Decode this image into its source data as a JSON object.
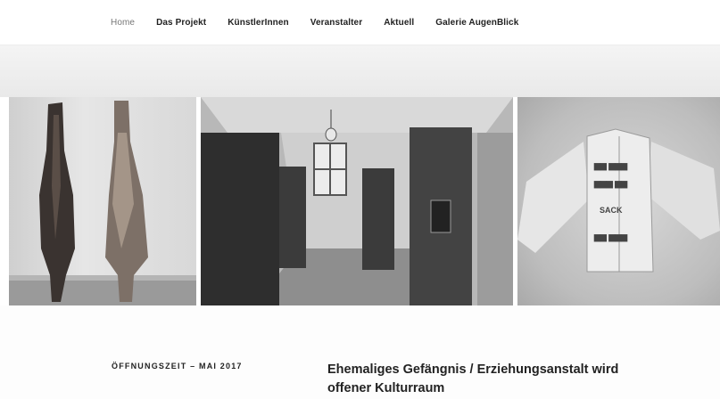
{
  "nav": {
    "items": [
      {
        "label": "Home",
        "active": true
      },
      {
        "label": "Das Projekt",
        "active": false
      },
      {
        "label": "KünstlerInnen",
        "active": false
      },
      {
        "label": "Veranstalter",
        "active": false
      },
      {
        "label": "Aktuell",
        "active": false
      },
      {
        "label": "Galerie AugenBlick",
        "active": false
      }
    ]
  },
  "gallery": {
    "left_image": "wooden-sculptures-photo",
    "center_image": "prison-corridor-photo",
    "right_image": "shirt-artwork-photo",
    "shirt_print": [
      "SACK"
    ]
  },
  "post": {
    "kicker": "ÖFFNUNGSZEIT – MAI 2017",
    "title_line1": "Ehemaliges Gefängnis / Erziehungsanstalt wird",
    "title_line2": "offener Kulturraum"
  }
}
